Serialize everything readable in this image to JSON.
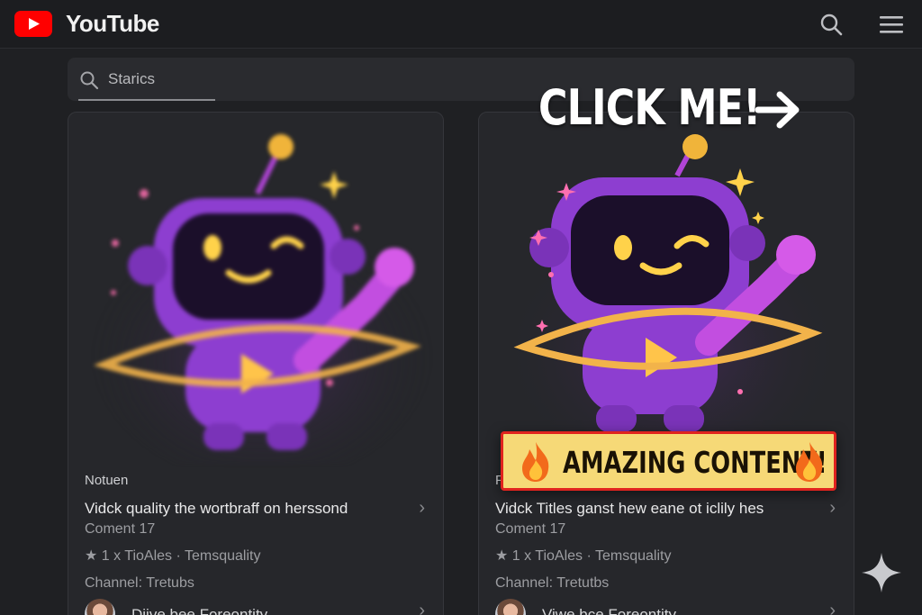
{
  "app": {
    "brand": "YouTube",
    "accent": "#ff0000"
  },
  "search": {
    "value": "Starics"
  },
  "overlay": {
    "headline": "CLICK ME!",
    "banner": "AMAZING CONTENT!",
    "banner_color": "#f6d977",
    "banner_border": "#e0231e"
  },
  "videos": [
    {
      "kicker": "Notuen",
      "title": "Vidck quality the wortbraff on herssond",
      "subtitle": "Coment 17",
      "stats": "★ 1 x TioAles · Temsquality",
      "channel": "Channel: Tretubs",
      "author": "Diive bee Foreontity"
    },
    {
      "kicker": "F",
      "title": "Vidck Titles ganst hew eane ot iclily hes",
      "subtitle": "Coment 17",
      "stats": "★ 1 x TioAles · Temsquality",
      "channel": "Channel: Tretutbs",
      "author": "Viwe bce Foreontity"
    }
  ],
  "icons": [
    "youtube-logo-icon",
    "search-icon",
    "menu-icon",
    "play-icon",
    "chevron-right-icon",
    "arrow-right-icon",
    "fire-icon",
    "sparkle-icon"
  ]
}
